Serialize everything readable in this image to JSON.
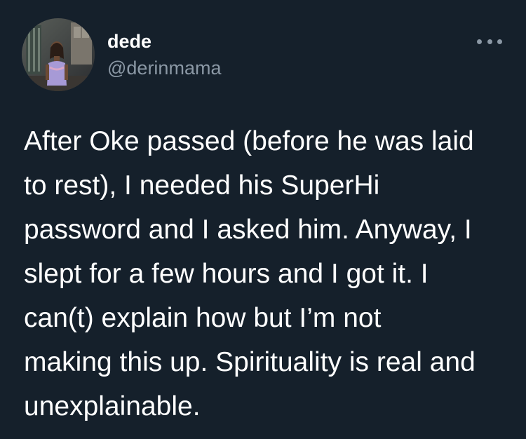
{
  "author": {
    "display_name": "dede",
    "handle": "@derinmama",
    "avatar_icon": "profile-photo"
  },
  "menu": {
    "icon": "more-horizontal-icon"
  },
  "tweet": {
    "lines": [
      "After Oke passed (before he was laid",
      "to rest), I needed his SuperHi",
      "password and I asked him. Anyway, I",
      "slept for a few hours and I got it. I",
      "can(t) explain how but I’m not",
      "making this up. Spirituality is real and",
      "unexplainable."
    ]
  },
  "colors": {
    "background": "#15202b",
    "text": "#ffffff",
    "secondary_text": "#8b98a5"
  }
}
